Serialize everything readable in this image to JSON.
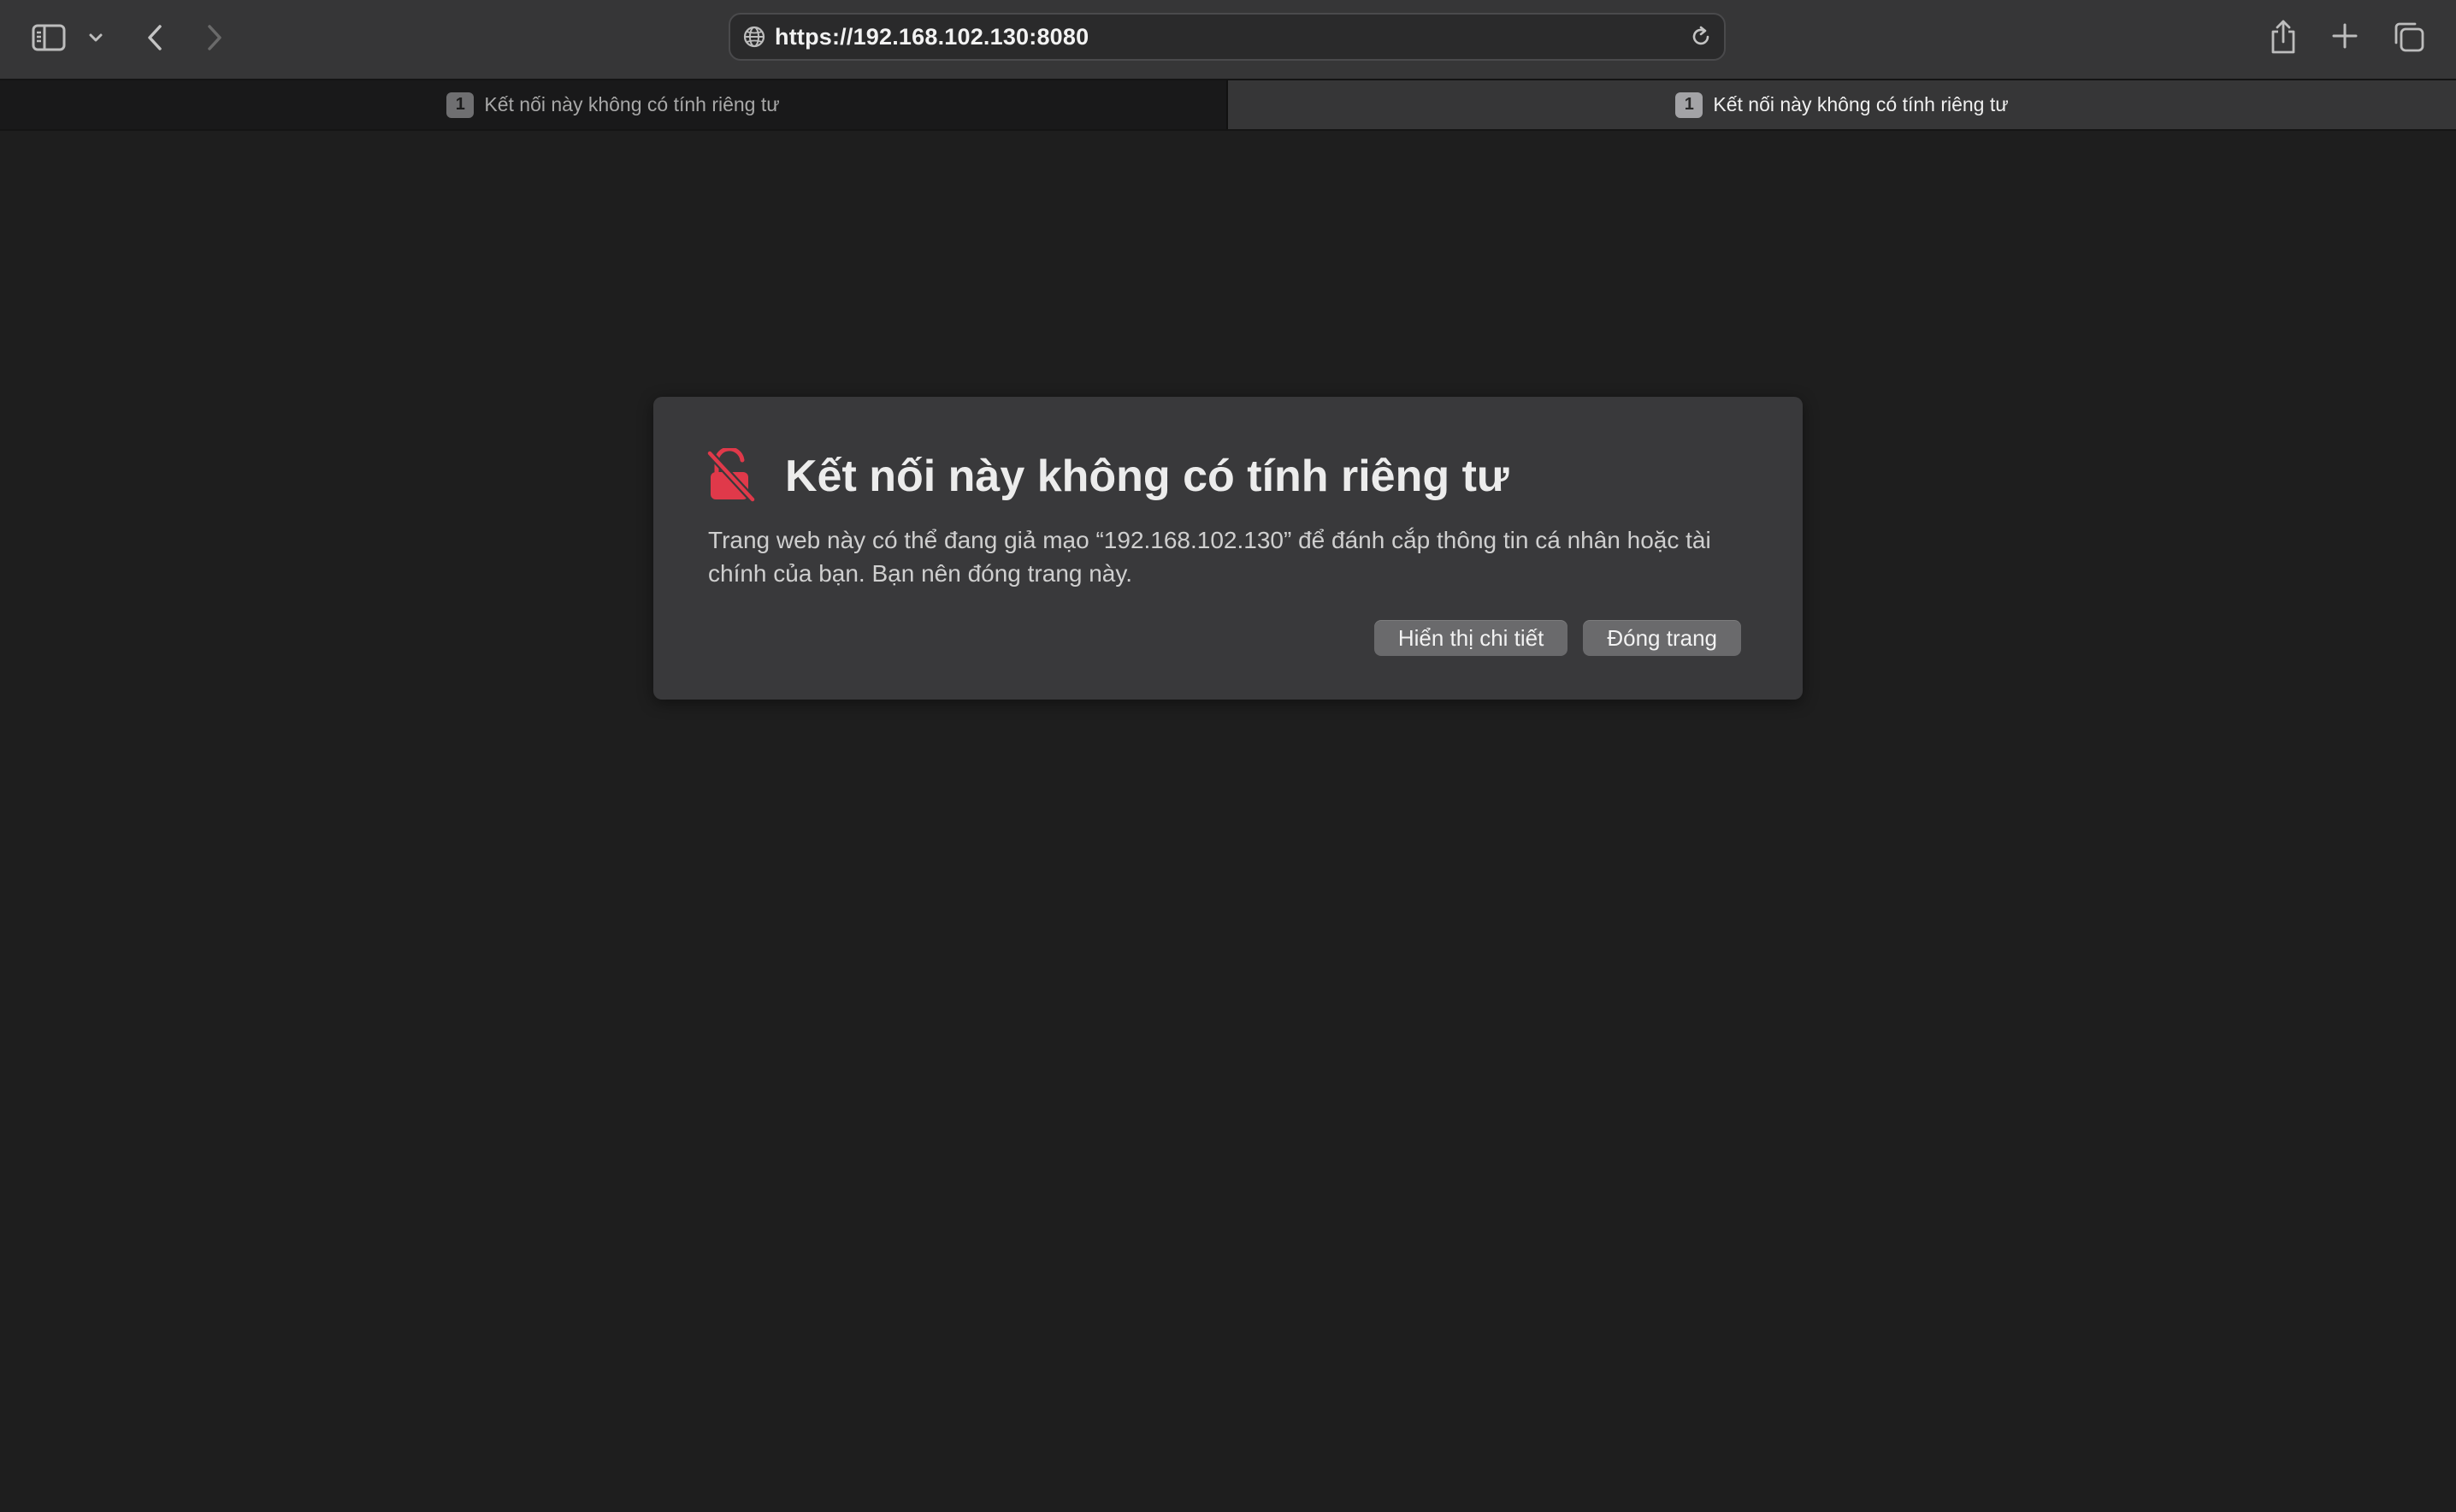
{
  "toolbar": {
    "url": "https://192.168.102.130:8080"
  },
  "tabs": [
    {
      "number": "1",
      "label": "Kết nối này không có tính riêng tư",
      "active": false
    },
    {
      "number": "1",
      "label": "Kết nối này không có tính riêng tư",
      "active": true
    }
  ],
  "dialog": {
    "title": "Kết nối này không có tính riêng tư",
    "message": "Trang web này có thể đang giả mạo “192.168.102.130” để đánh cắp thông tin cá nhân hoặc tài chính của bạn. Bạn nên đóng trang này.",
    "details_label": "Hiển thị chi tiết",
    "close_label": "Đóng trang"
  },
  "colors": {
    "background": "#1e1e1e",
    "toolbar": "#363637",
    "dialog": "#39393b",
    "warning_red": "#e0394a",
    "button": "#6a6a6c"
  },
  "icons": {
    "sidebar": "sidebar-icon",
    "chevron": "chevron-down-icon",
    "back": "back-arrow-icon",
    "forward": "forward-arrow-icon",
    "globe": "globe-icon",
    "reload": "reload-icon",
    "share": "share-icon",
    "new_tab": "plus-icon",
    "tab_overview": "tab-overview-icon",
    "warning": "unlocked-lock-slash-icon"
  }
}
